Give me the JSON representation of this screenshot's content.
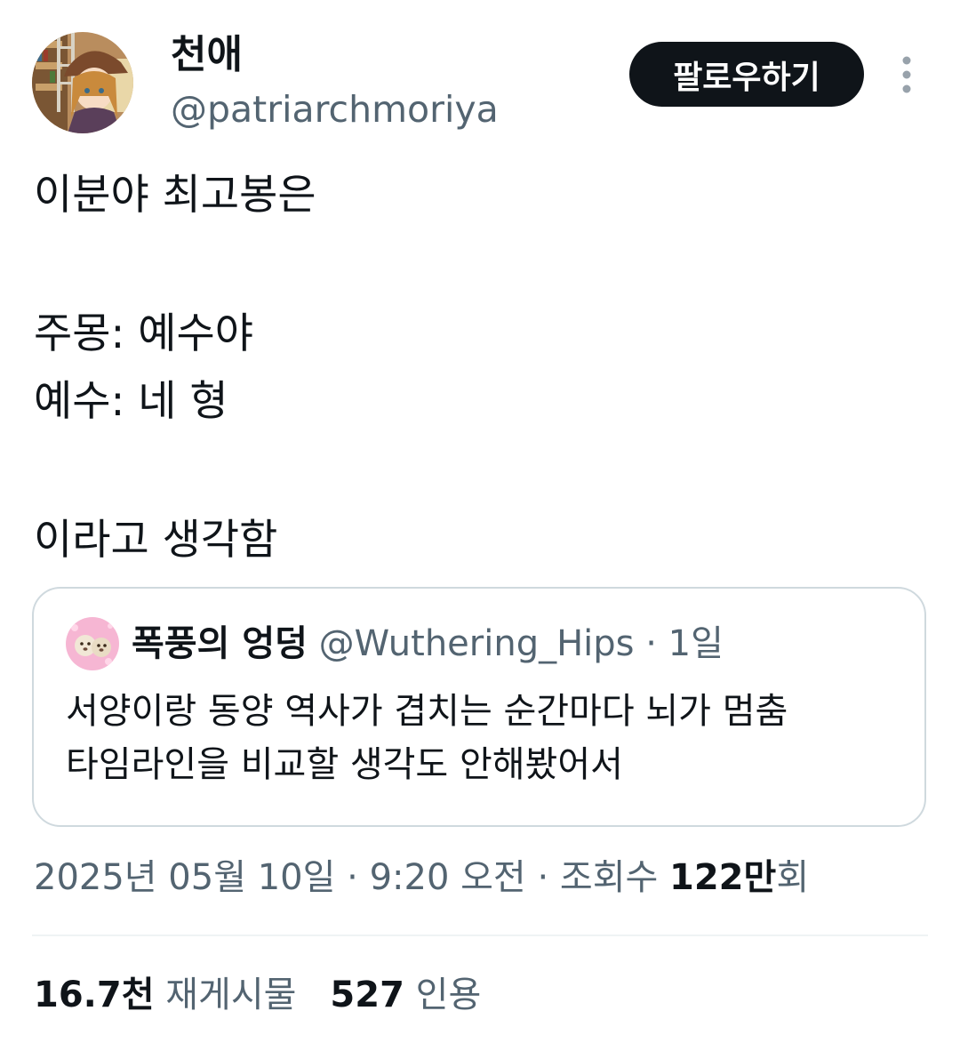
{
  "author": {
    "display_name": "천애",
    "handle": "@patriarchmoriya",
    "avatar_icon": "anime-girl-avatar"
  },
  "actions": {
    "follow_label": "팔로우하기",
    "more_icon": "more-vertical-icon"
  },
  "tweet": {
    "lines": [
      "이분야 최고봉은",
      "주몽: 예수야",
      "예수: 네 형",
      "이라고 생각함"
    ]
  },
  "quote": {
    "avatar_icon": "dogs-avatar",
    "display_name": "폭풍의 엉덩",
    "handle": "@Wuthering_Hips",
    "separator": " · ",
    "time": "1일",
    "lines": [
      "서양이랑 동양 역사가 겹치는 순간마다 뇌가 멈춤",
      "타임라인을 비교할 생각도 안해봤어서"
    ]
  },
  "meta": {
    "date": "2025년 05월 10일",
    "separator": " · ",
    "time": "9:20 오전",
    "views_label": "조회수",
    "views_value": "122만",
    "views_suffix": "회"
  },
  "stats": {
    "reposts_value": "16.7천",
    "reposts_label": "재게시물",
    "quotes_value": "527",
    "quotes_label": "인용"
  },
  "colors": {
    "text_primary": "#0f1419",
    "text_secondary": "#536471",
    "border": "#cfd9de",
    "follow_bg": "#0f1419"
  }
}
